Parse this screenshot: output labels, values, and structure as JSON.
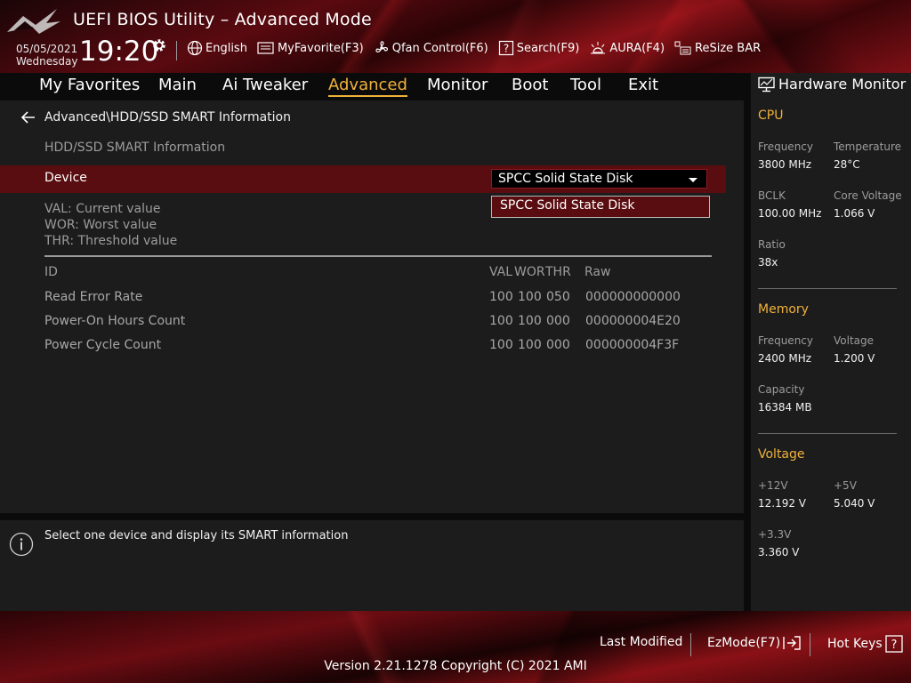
{
  "header": {
    "app_title": "UEFI BIOS Utility – Advanced Mode",
    "date": "05/05/2021",
    "weekday": "Wednesday",
    "time": "19:20",
    "toolbar": [
      {
        "label": "English",
        "icon": "globe-icon"
      },
      {
        "label": "MyFavorite(F3)",
        "icon": "favorite-icon"
      },
      {
        "label": "Qfan Control(F6)",
        "icon": "fan-icon"
      },
      {
        "label": "Search(F9)",
        "icon": "search-icon"
      },
      {
        "label": "AURA(F4)",
        "icon": "aura-icon"
      },
      {
        "label": "ReSize BAR",
        "icon": "resize-bar-icon"
      }
    ]
  },
  "nav": {
    "tabs": [
      "My Favorites",
      "Main",
      "Ai Tweaker",
      "Advanced",
      "Monitor",
      "Boot",
      "Tool",
      "Exit"
    ],
    "active": "Advanced"
  },
  "main": {
    "breadcrumb": "Advanced\\HDD/SSD SMART Information",
    "subtitle": "HDD/SSD SMART Information",
    "device_label": "Device",
    "device_value": "SPCC Solid State Disk",
    "dropdown_option": "SPCC Solid State Disk",
    "legend": [
      "VAL:  Current value",
      "WOR: Worst value",
      "THR:  Threshold value"
    ],
    "table": {
      "headers": [
        "ID",
        "VAL",
        "WOR",
        "THR",
        "Raw"
      ],
      "rows": [
        {
          "id": "Read Error Rate",
          "val": "100",
          "wor": "100",
          "thr": "050",
          "raw": "000000000000"
        },
        {
          "id": "Power-On Hours Count",
          "val": "100",
          "wor": "100",
          "thr": "000",
          "raw": "000000004E20"
        },
        {
          "id": "Power Cycle Count",
          "val": "100",
          "wor": "100",
          "thr": "000",
          "raw": "000000004F3F"
        }
      ]
    }
  },
  "help": {
    "text": "Select one device and display its SMART information"
  },
  "hardware_monitor": {
    "title": "Hardware Monitor",
    "cpu": {
      "title": "CPU",
      "frequency_label": "Frequency",
      "frequency": "3800 MHz",
      "temperature_label": "Temperature",
      "temperature": "28°C",
      "bclk_label": "BCLK",
      "bclk": "100.00 MHz",
      "core_voltage_label": "Core Voltage",
      "core_voltage": "1.066 V",
      "ratio_label": "Ratio",
      "ratio": "38x"
    },
    "memory": {
      "title": "Memory",
      "frequency_label": "Frequency",
      "frequency": "2400 MHz",
      "voltage_label": "Voltage",
      "voltage": "1.200 V",
      "capacity_label": "Capacity",
      "capacity": "16384 MB"
    },
    "voltage": {
      "title": "Voltage",
      "v12_label": "+12V",
      "v12": "12.192 V",
      "v5_label": "+5V",
      "v5": "5.040 V",
      "v33_label": "+3.3V",
      "v33": "3.360 V"
    }
  },
  "footer": {
    "last_modified": "Last Modified",
    "ezmode": "EzMode(F7)",
    "hot_keys": "Hot Keys",
    "version": "Version 2.21.1278 Copyright (C) 2021 AMI"
  },
  "colors": {
    "accent": "#f0b23a",
    "highlight_row": "#5a0d10",
    "panel": "#1c1c1c"
  }
}
